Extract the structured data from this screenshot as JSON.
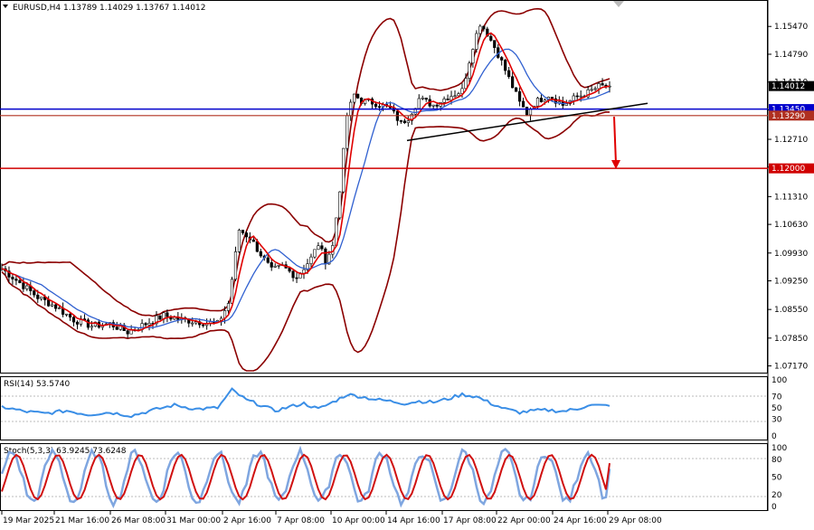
{
  "colors": {
    "candle": "#000000",
    "bollinger": "#8b0000",
    "ma_fast": "#e00000",
    "ma_slow": "#3060d0",
    "rsi_line": "#3a8ee6",
    "stoch_main": "#7fa6e0",
    "stoch_signal": "#d01010",
    "support_blue": "#0000cc",
    "level_brown": "#b03020",
    "level_red": "#d00000",
    "current_price_bg": "#000000",
    "trendline": "#000000"
  },
  "header": {
    "symbol_title": "EURUSD,H4  1.13789 1.14029 1.13767 1.14012"
  },
  "price_axis": {
    "ticks": [
      "1.15470",
      "1.14790",
      "1.14110",
      "1.13430",
      "1.12710",
      "1.12030",
      "1.11310",
      "1.10630",
      "1.09930",
      "1.09250",
      "1.08550",
      "1.07850",
      "1.07170"
    ]
  },
  "price_labels": {
    "current": "1.14012",
    "blue_level": "1.13450",
    "brown_level": "1.13290",
    "red_level": "1.12000"
  },
  "rsi": {
    "title": "RSI(14) 53.5740",
    "ticks": [
      "100",
      "70",
      "50",
      "30",
      "0"
    ]
  },
  "stoch": {
    "title": "Stoch(5,3,3) 63.9245 73.6248",
    "ticks": [
      "100",
      "80",
      "50",
      "20",
      "0"
    ]
  },
  "time_axis": {
    "ticks": [
      "19 Mar 2025",
      "21 Mar 16:00",
      "26 Mar 08:00",
      "31 Mar 00:00",
      "2 Apr 16:00",
      "7 Apr 08:00",
      "10 Apr 00:00",
      "14 Apr 16:00",
      "17 Apr 08:00",
      "22 Apr 00:00",
      "24 Apr 16:00",
      "29 Apr 08:00"
    ]
  },
  "chart_data": {
    "type": "candlestick",
    "symbol": "EURUSD",
    "timeframe": "H4",
    "last_bar": {
      "open": 1.13789,
      "high": 1.14029,
      "low": 1.13767,
      "close": 1.14012
    },
    "ylim": [
      1.0705,
      1.1605
    ],
    "horizontal_levels": [
      {
        "name": "support",
        "value": 1.1345
      },
      {
        "name": "level",
        "value": 1.1329
      },
      {
        "name": "target",
        "value": 1.12
      }
    ],
    "trendline": {
      "from": {
        "x": "14 Apr 16:00",
        "y": 1.1268
      },
      "to": {
        "x": "29 Apr 08:00",
        "y": 1.1359
      }
    },
    "close_path": [
      [
        0,
        1.0955
      ],
      [
        5,
        1.092
      ],
      [
        10,
        1.0885
      ],
      [
        15,
        1.0862
      ],
      [
        20,
        1.083
      ],
      [
        25,
        1.0815
      ],
      [
        30,
        1.082
      ],
      [
        35,
        1.08
      ],
      [
        40,
        1.082
      ],
      [
        45,
        1.084
      ],
      [
        50,
        1.083
      ],
      [
        55,
        1.0825
      ],
      [
        60,
        1.082
      ],
      [
        63,
        1.087
      ],
      [
        66,
        1.105
      ],
      [
        69,
        1.103
      ],
      [
        72,
        1.099
      ],
      [
        75,
        1.095
      ],
      [
        78,
        1.096
      ],
      [
        82,
        1.0935
      ],
      [
        86,
        1.098
      ],
      [
        88,
        1.1015
      ],
      [
        90,
        1.0975
      ],
      [
        92,
        1.101
      ],
      [
        94,
        1.115
      ],
      [
        96,
        1.133
      ],
      [
        98,
        1.138
      ],
      [
        100,
        1.1365
      ],
      [
        104,
        1.136
      ],
      [
        108,
        1.1345
      ],
      [
        111,
        1.131
      ],
      [
        113,
        1.1325
      ],
      [
        116,
        1.137
      ],
      [
        120,
        1.1355
      ],
      [
        124,
        1.1375
      ],
      [
        128,
        1.139
      ],
      [
        131,
        1.15
      ],
      [
        133,
        1.1555
      ],
      [
        135,
        1.153
      ],
      [
        138,
        1.148
      ],
      [
        141,
        1.142
      ],
      [
        144,
        1.136
      ],
      [
        146,
        1.1335
      ],
      [
        148,
        1.136
      ],
      [
        152,
        1.138
      ],
      [
        156,
        1.1355
      ],
      [
        160,
        1.1375
      ],
      [
        163,
        1.1385
      ],
      [
        166,
        1.14
      ]
    ],
    "rsi_path": [
      [
        0,
        52
      ],
      [
        6,
        44
      ],
      [
        12,
        40
      ],
      [
        18,
        45
      ],
      [
        24,
        38
      ],
      [
        30,
        42
      ],
      [
        36,
        36
      ],
      [
        42,
        46
      ],
      [
        48,
        55
      ],
      [
        54,
        48
      ],
      [
        60,
        50
      ],
      [
        64,
        82
      ],
      [
        68,
        64
      ],
      [
        72,
        55
      ],
      [
        76,
        45
      ],
      [
        80,
        52
      ],
      [
        84,
        58
      ],
      [
        88,
        48
      ],
      [
        92,
        60
      ],
      [
        96,
        74
      ],
      [
        100,
        70
      ],
      [
        104,
        65
      ],
      [
        108,
        62
      ],
      [
        112,
        58
      ],
      [
        116,
        62
      ],
      [
        120,
        60
      ],
      [
        124,
        66
      ],
      [
        128,
        74
      ],
      [
        132,
        70
      ],
      [
        136,
        58
      ],
      [
        140,
        48
      ],
      [
        144,
        42
      ],
      [
        148,
        45
      ],
      [
        152,
        46
      ],
      [
        156,
        44
      ],
      [
        160,
        48
      ],
      [
        163,
        55
      ],
      [
        166,
        54
      ]
    ],
    "rsi_last": 53.574,
    "stoch_last": {
      "k": 63.9245,
      "d": 73.6248
    }
  }
}
